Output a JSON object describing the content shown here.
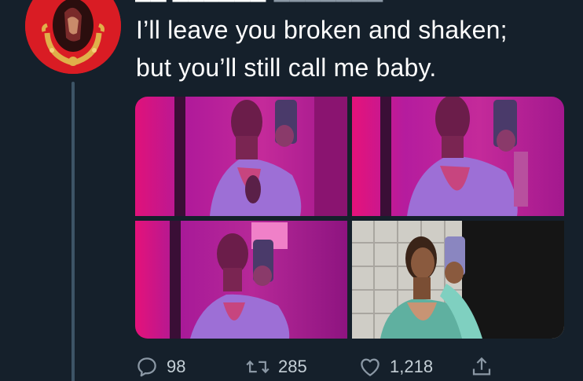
{
  "tweet": {
    "text_lines": [
      "I’ll leave you broken and shaken;",
      "but you’ll still call me baby."
    ]
  },
  "media": {
    "images": [
      {
        "name": "photo-1",
        "kind": "mirror selfie, pink lighting"
      },
      {
        "name": "photo-2",
        "kind": "mirror selfie, pink lighting"
      },
      {
        "name": "photo-3",
        "kind": "mirror selfie, pink lighting"
      },
      {
        "name": "photo-4",
        "kind": "mirror selfie, tiled wall"
      }
    ]
  },
  "actions": {
    "reply_count": "98",
    "retweet_count": "285",
    "like_count": "1,218",
    "icons": [
      "reply-icon",
      "retweet-icon",
      "like-icon",
      "share-icon"
    ]
  },
  "colors": {
    "background": "#15202b",
    "text": "#ffffff",
    "muted": "#8b98a5",
    "thread_line": "#3d5466",
    "avatar_red": "#d91c24"
  }
}
